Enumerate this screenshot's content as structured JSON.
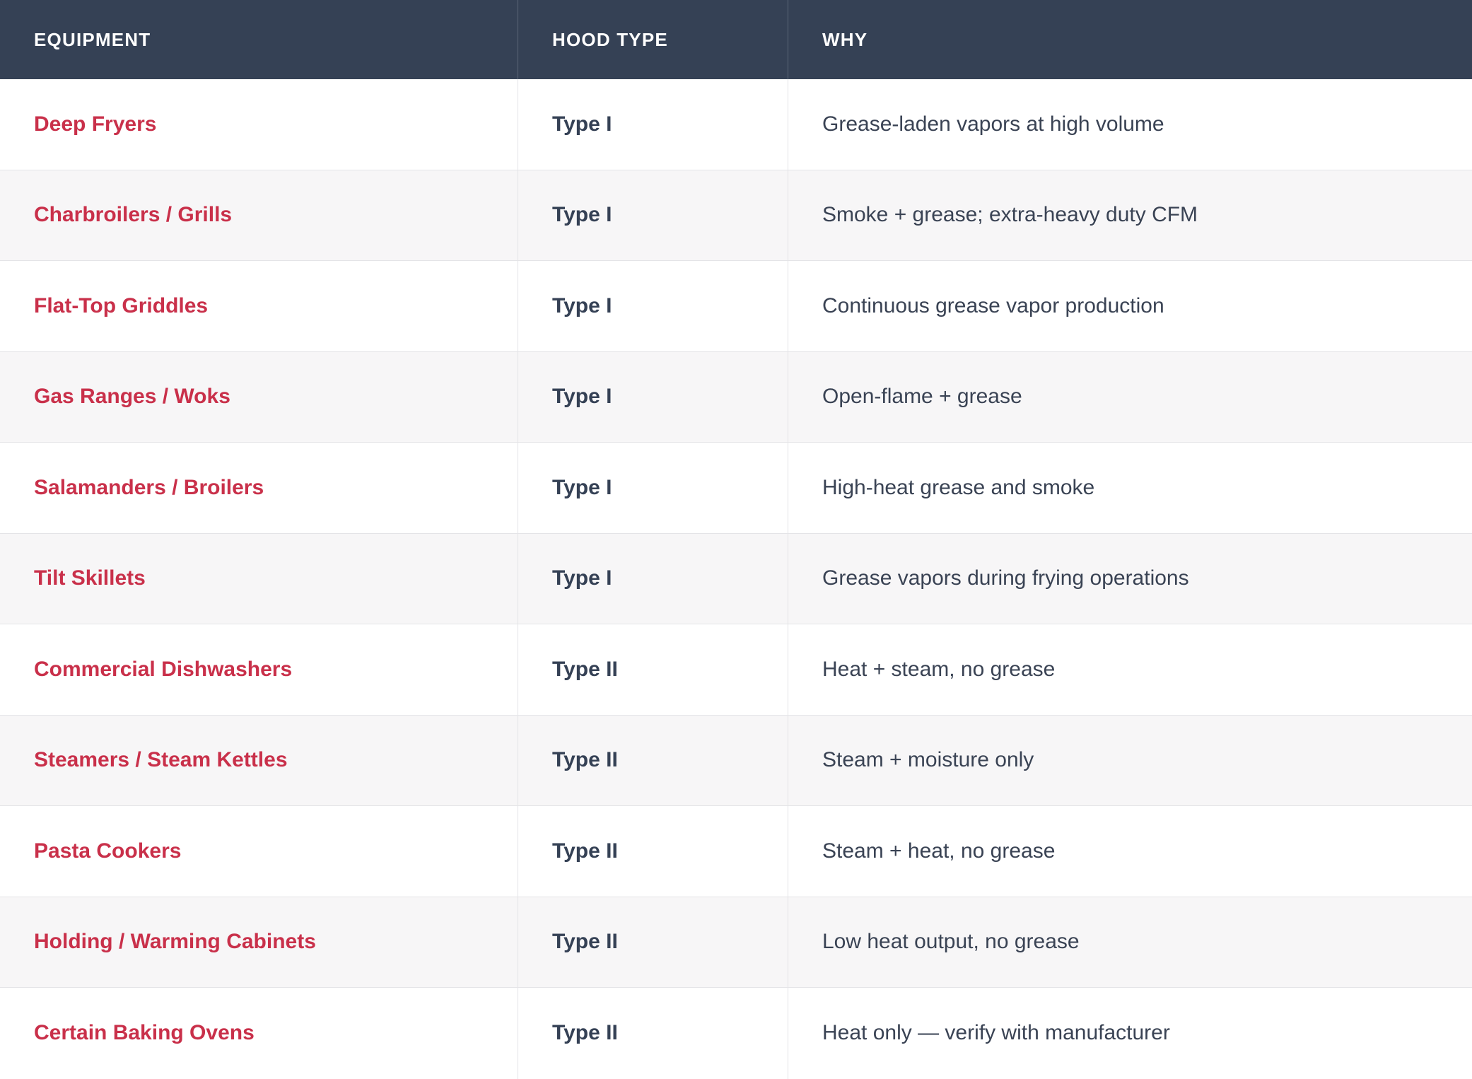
{
  "headers": {
    "equipment": "EQUIPMENT",
    "hood_type": "HOOD TYPE",
    "why": "WHY"
  },
  "rows": [
    {
      "equipment": "Deep Fryers",
      "hood_type": "Type I",
      "why": "Grease-laden vapors at high volume"
    },
    {
      "equipment": "Charbroilers / Grills",
      "hood_type": "Type I",
      "why": "Smoke + grease; extra-heavy duty CFM"
    },
    {
      "equipment": "Flat-Top Griddles",
      "hood_type": "Type I",
      "why": "Continuous grease vapor production"
    },
    {
      "equipment": "Gas Ranges / Woks",
      "hood_type": "Type I",
      "why": "Open-flame + grease"
    },
    {
      "equipment": "Salamanders / Broilers",
      "hood_type": "Type I",
      "why": "High-heat grease and smoke"
    },
    {
      "equipment": "Tilt Skillets",
      "hood_type": "Type I",
      "why": "Grease vapors during frying operations"
    },
    {
      "equipment": "Commercial Dishwashers",
      "hood_type": "Type II",
      "why": "Heat + steam, no grease"
    },
    {
      "equipment": "Steamers / Steam Kettles",
      "hood_type": "Type II",
      "why": "Steam + moisture only"
    },
    {
      "equipment": "Pasta Cookers",
      "hood_type": "Type II",
      "why": "Steam + heat, no grease"
    },
    {
      "equipment": "Holding / Warming Cabinets",
      "hood_type": "Type II",
      "why": "Low heat output, no grease"
    },
    {
      "equipment": "Certain Baking Ovens",
      "hood_type": "Type II",
      "why": "Heat only — verify with manufacturer"
    }
  ],
  "colors": {
    "header_bg": "#354155",
    "equipment_text": "#c9304a",
    "alt_row_bg": "#f7f6f7"
  }
}
